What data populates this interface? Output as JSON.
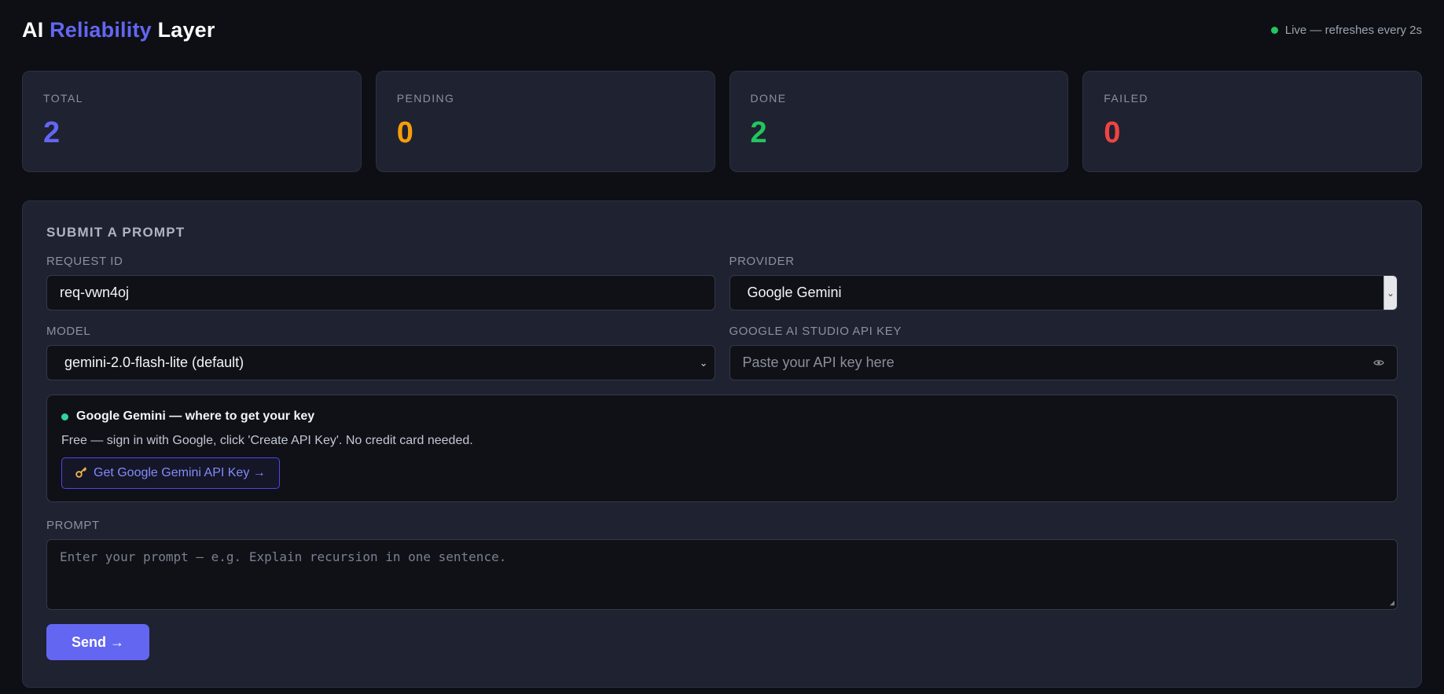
{
  "header": {
    "brand_prefix": "AI",
    "brand_accent": "Reliability",
    "brand_suffix": "Layer",
    "live_status": "Live — refreshes every 2s"
  },
  "stats": [
    {
      "label": "TOTAL",
      "value": "2",
      "color": "#6366f1"
    },
    {
      "label": "PENDING",
      "value": "0",
      "color": "#f59e0b"
    },
    {
      "label": "DONE",
      "value": "2",
      "color": "#22c55e"
    },
    {
      "label": "FAILED",
      "value": "0",
      "color": "#ef4444"
    }
  ],
  "form": {
    "title": "SUBMIT A PROMPT",
    "request_id_label": "REQUEST ID",
    "request_id_value": "req-vwn4oj",
    "provider_label": "PROVIDER",
    "provider_value": "Google Gemini",
    "model_label": "MODEL",
    "model_value": "gemini-2.0-flash-lite (default)",
    "api_key_label": "GOOGLE AI STUDIO API KEY",
    "api_key_placeholder": "Paste your API key here",
    "info": {
      "heading": "Google Gemini — where to get your key",
      "text": "Free — sign in with Google, click 'Create API Key'. No credit card needed.",
      "button_label": "Get Google Gemini API Key →"
    },
    "prompt_label": "PROMPT",
    "prompt_placeholder": "Enter your prompt — e.g. Explain recursion in one sentence.",
    "send_label": "Send →"
  },
  "icons": {
    "live": "status-dot",
    "select_chevron": "chevron-down-icon",
    "api_key_visibility": "eye-icon",
    "info": "status-dot",
    "key_button": "key-icon"
  }
}
